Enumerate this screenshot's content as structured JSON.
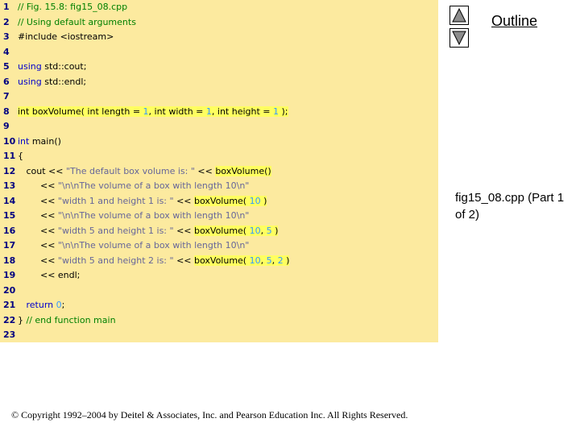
{
  "outline": {
    "title": "Outline"
  },
  "nav": {
    "up_icon": "triangle-up-icon",
    "down_icon": "triangle-down-icon"
  },
  "caption": {
    "text": "fig15_08.cpp (Part 1 of 2)"
  },
  "copyright": "© Copyright 1992–2004 by Deitel & Associates, Inc. and Pearson Education Inc. All Rights Reserved.",
  "colors": {
    "panel_bg": "#fcea9f",
    "highlight": "#ffff60",
    "comment": "#008000",
    "keyword": "#0000cc",
    "string": "#666699",
    "number": "#3399ff",
    "plain": "#000000",
    "line_number": "#000080"
  },
  "code": [
    {
      "n": "1",
      "tokens": [
        {
          "t": "// Fig. 15.8: fig15_08.cpp",
          "c": "comment"
        }
      ]
    },
    {
      "n": "2",
      "tokens": [
        {
          "t": "// Using default arguments",
          "c": "comment"
        }
      ]
    },
    {
      "n": "3",
      "tokens": [
        {
          "t": "#include <iostream>",
          "c": "plain"
        }
      ]
    },
    {
      "n": "4",
      "tokens": []
    },
    {
      "n": "5",
      "tokens": [
        {
          "t": "using",
          "c": "keyword"
        },
        {
          "t": " std::cout;",
          "c": "plain"
        }
      ]
    },
    {
      "n": "6",
      "tokens": [
        {
          "t": "using",
          "c": "keyword"
        },
        {
          "t": " std::endl;",
          "c": "plain"
        }
      ]
    },
    {
      "n": "7",
      "tokens": []
    },
    {
      "n": "8",
      "tokens": [
        {
          "t": "int boxVolume( int length = ",
          "c": "plain",
          "h": true
        },
        {
          "t": "1",
          "c": "number",
          "h": true
        },
        {
          "t": ", int width = ",
          "c": "plain",
          "h": true
        },
        {
          "t": "1",
          "c": "number",
          "h": true
        },
        {
          "t": ", int height = ",
          "c": "plain",
          "h": true
        },
        {
          "t": "1",
          "c": "number",
          "h": true
        },
        {
          "t": " );",
          "c": "plain",
          "h": true
        }
      ]
    },
    {
      "n": "9",
      "tokens": []
    },
    {
      "n": "10",
      "tokens": [
        {
          "t": "int",
          "c": "keyword"
        },
        {
          "t": " main()",
          "c": "plain"
        }
      ]
    },
    {
      "n": "11",
      "tokens": [
        {
          "t": "{",
          "c": "plain"
        }
      ]
    },
    {
      "n": "12",
      "tokens": [
        {
          "t": "   cout << ",
          "c": "plain"
        },
        {
          "t": "\"The default box volume is: \"",
          "c": "string"
        },
        {
          "t": " << ",
          "c": "plain"
        },
        {
          "t": "boxVolume()",
          "c": "plain",
          "h": true
        }
      ]
    },
    {
      "n": "13",
      "tokens": [
        {
          "t": "        << ",
          "c": "plain"
        },
        {
          "t": "\"\\n\\nThe volume of a box with length 10\\n\"",
          "c": "string"
        }
      ]
    },
    {
      "n": "14",
      "tokens": [
        {
          "t": "        << ",
          "c": "plain"
        },
        {
          "t": "\"width 1 and height 1 is: \"",
          "c": "string"
        },
        {
          "t": " << ",
          "c": "plain"
        },
        {
          "t": "boxVolume( ",
          "c": "plain",
          "h": true
        },
        {
          "t": "10",
          "c": "number",
          "h": true
        },
        {
          "t": " )",
          "c": "plain",
          "h": true
        }
      ]
    },
    {
      "n": "15",
      "tokens": [
        {
          "t": "        << ",
          "c": "plain"
        },
        {
          "t": "\"\\n\\nThe volume of a box with length 10\\n\"",
          "c": "string"
        }
      ]
    },
    {
      "n": "16",
      "tokens": [
        {
          "t": "        << ",
          "c": "plain"
        },
        {
          "t": "\"width 5 and height 1 is: \"",
          "c": "string"
        },
        {
          "t": " << ",
          "c": "plain"
        },
        {
          "t": "boxVolume( ",
          "c": "plain",
          "h": true
        },
        {
          "t": "10",
          "c": "number",
          "h": true
        },
        {
          "t": ", ",
          "c": "plain",
          "h": true
        },
        {
          "t": "5",
          "c": "number",
          "h": true
        },
        {
          "t": " )",
          "c": "plain",
          "h": true
        }
      ]
    },
    {
      "n": "17",
      "tokens": [
        {
          "t": "        << ",
          "c": "plain"
        },
        {
          "t": "\"\\n\\nThe volume of a box with length 10\\n\"",
          "c": "string"
        }
      ]
    },
    {
      "n": "18",
      "tokens": [
        {
          "t": "        << ",
          "c": "plain"
        },
        {
          "t": "\"width 5 and height 2 is: \"",
          "c": "string"
        },
        {
          "t": " << ",
          "c": "plain"
        },
        {
          "t": "boxVolume( ",
          "c": "plain",
          "h": true
        },
        {
          "t": "10",
          "c": "number",
          "h": true
        },
        {
          "t": ", ",
          "c": "plain",
          "h": true
        },
        {
          "t": "5",
          "c": "number",
          "h": true
        },
        {
          "t": ", ",
          "c": "plain",
          "h": true
        },
        {
          "t": "2",
          "c": "number",
          "h": true
        },
        {
          "t": " )",
          "c": "plain",
          "h": true
        }
      ]
    },
    {
      "n": "19",
      "tokens": [
        {
          "t": "        << endl;",
          "c": "plain"
        }
      ]
    },
    {
      "n": "20",
      "tokens": []
    },
    {
      "n": "21",
      "tokens": [
        {
          "t": "   ",
          "c": "plain"
        },
        {
          "t": "return",
          "c": "keyword"
        },
        {
          "t": " ",
          "c": "plain"
        },
        {
          "t": "0",
          "c": "number"
        },
        {
          "t": ";",
          "c": "plain"
        }
      ]
    },
    {
      "n": "22",
      "tokens": [
        {
          "t": "} ",
          "c": "plain"
        },
        {
          "t": "// end function main",
          "c": "comment"
        }
      ]
    },
    {
      "n": "23",
      "tokens": []
    }
  ]
}
